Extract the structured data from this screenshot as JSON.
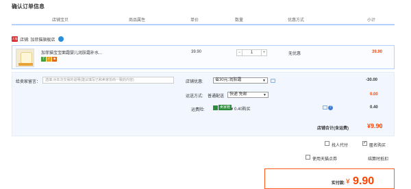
{
  "page": {
    "title": "确认订单信息"
  },
  "columns": [
    "店铺宝贝",
    "商品属性",
    "单价",
    "数量",
    "优惠方式",
    "小计"
  ],
  "shop": {
    "icon_text": "天猫",
    "label": "店铺: 加菲猫旗舰店"
  },
  "item": {
    "title": "加菲猫宝宝面霜婴儿润肤霜补水...",
    "badges": [
      "7",
      "✓",
      "■"
    ],
    "price": "39.90",
    "quantity": "1",
    "minus": "−",
    "plus": "+",
    "discount": "无优惠",
    "subtotal": "39.90"
  },
  "options": {
    "note_label": "给卖家留言：",
    "note_placeholder": "选填:对本次交易的说明(建议填写已和卖家协商一致的内容)",
    "coupon_label": "店铺优惠:",
    "coupon_value": "省30元:润肤霜",
    "coupon_amount": "-30.00",
    "shipping_label": "运送方式:",
    "shipping_method": "普通配送",
    "shipping_value": "快递 免邮",
    "shipping_amount": "0.00",
    "insurance_label": "运费险:",
    "insurance_badge": "卖家赠",
    "insurance_text": "¥ 0.40购买",
    "insurance_amount": "0.40",
    "help_icon": "?",
    "shop_total_label": "店铺合计(含运费)",
    "shop_total": "¥9.90"
  },
  "checkout": {
    "proxy_pay": "找人代付",
    "anonymous": "匿名购买",
    "anonymous_checked": true,
    "use_points": "使用天猫点券",
    "settle_link": "结算时抵扣"
  },
  "payment": {
    "label": "实付款:",
    "currency": "¥",
    "amount": "9.90"
  },
  "colors": {
    "accent": "#ff4400",
    "border": "#b2d1ff",
    "panel": "#f2f7ff"
  }
}
